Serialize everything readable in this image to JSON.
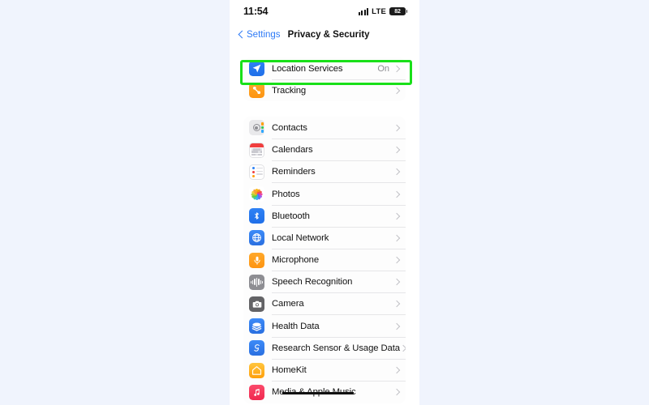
{
  "page": {
    "background_color": "#f0f4fd"
  },
  "status_bar": {
    "time": "11:54",
    "carrier_tech": "LTE",
    "battery_level": "82",
    "signal_icon": "cellular-signal-icon",
    "battery_icon": "battery-icon"
  },
  "nav": {
    "back_label": "Settings",
    "back_icon": "chevron-left-icon",
    "title": "Privacy & Security"
  },
  "highlight": {
    "color": "#19e019",
    "target": "Location Services"
  },
  "groups": [
    {
      "id": "location-group",
      "rows": [
        {
          "label": "Location Services",
          "value": "On",
          "icon": "location-arrow-icon",
          "chevron": "chevron-right-icon",
          "highlighted": true
        },
        {
          "label": "Tracking",
          "value": "",
          "icon": "tracking-icon",
          "chevron": "chevron-right-icon",
          "highlighted": false
        }
      ]
    },
    {
      "id": "permissions-group",
      "rows": [
        {
          "label": "Contacts",
          "value": "",
          "icon": "contacts-icon",
          "chevron": "chevron-right-icon",
          "highlighted": false
        },
        {
          "label": "Calendars",
          "value": "",
          "icon": "calendar-icon",
          "chevron": "chevron-right-icon",
          "highlighted": false
        },
        {
          "label": "Reminders",
          "value": "",
          "icon": "reminders-icon",
          "chevron": "chevron-right-icon",
          "highlighted": false
        },
        {
          "label": "Photos",
          "value": "",
          "icon": "photos-icon",
          "chevron": "chevron-right-icon",
          "highlighted": false
        },
        {
          "label": "Bluetooth",
          "value": "",
          "icon": "bluetooth-icon",
          "chevron": "chevron-right-icon",
          "highlighted": false
        },
        {
          "label": "Local Network",
          "value": "",
          "icon": "local-network-icon",
          "chevron": "chevron-right-icon",
          "highlighted": false
        },
        {
          "label": "Microphone",
          "value": "",
          "icon": "microphone-icon",
          "chevron": "chevron-right-icon",
          "highlighted": false
        },
        {
          "label": "Speech Recognition",
          "value": "",
          "icon": "speech-recognition-icon",
          "chevron": "chevron-right-icon",
          "highlighted": false
        },
        {
          "label": "Camera",
          "value": "",
          "icon": "camera-icon",
          "chevron": "chevron-right-icon",
          "highlighted": false
        },
        {
          "label": "Health Data",
          "value": "",
          "icon": "health-icon",
          "chevron": "chevron-right-icon",
          "highlighted": false
        },
        {
          "label": "Research Sensor & Usage Data",
          "value": "",
          "icon": "research-sensor-icon",
          "chevron": "chevron-right-icon",
          "highlighted": false
        },
        {
          "label": "HomeKit",
          "value": "",
          "icon": "homekit-icon",
          "chevron": "chevron-right-icon",
          "highlighted": false
        },
        {
          "label": "Media & Apple Music",
          "value": "",
          "icon": "media-music-icon",
          "chevron": "chevron-right-icon",
          "highlighted": false,
          "redacted": true
        }
      ]
    }
  ]
}
